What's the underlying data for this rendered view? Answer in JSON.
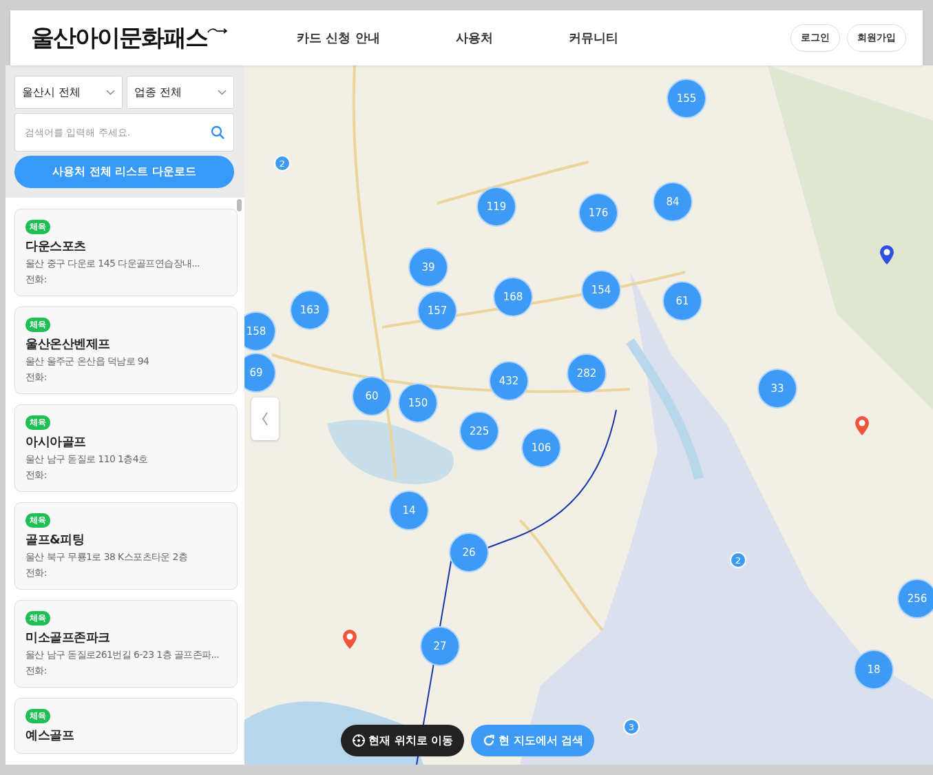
{
  "header": {
    "logo": "울산아이문화패스",
    "nav": [
      {
        "label": "카드 신청 안내"
      },
      {
        "label": "사용처"
      },
      {
        "label": "커뮤니티"
      }
    ],
    "auth_buttons": [
      "로그인",
      "회원가입"
    ]
  },
  "filters": {
    "region": "울산시 전체",
    "category": "업종 전체",
    "search": {
      "placeholder": "검색어를 입력해 주세요."
    },
    "download_button": "사용처 전체 리스트 다운로드"
  },
  "places": [
    {
      "tag": "체육",
      "name": "다운스포츠",
      "address": "울산 중구 다운로 145 다운골프연습장내...",
      "phone": "전화:"
    },
    {
      "tag": "체육",
      "name": "울산온산벤제프",
      "address": "울산 울주군 온산읍 덕남로 94",
      "phone": "전화:"
    },
    {
      "tag": "체육",
      "name": "아시아골프",
      "address": "울산 남구 돋질로 110 1층4호",
      "phone": "전화:"
    },
    {
      "tag": "체육",
      "name": "골프&피팅",
      "address": "울산 북구 무룡1로 38 K스포츠타운 2층",
      "phone": "전화:"
    },
    {
      "tag": "체육",
      "name": "미소골프존파크",
      "address": "울산 남구 돋질로261번길 6-23 1층 골프존파...",
      "phone": "전화:"
    },
    {
      "tag": "체육",
      "name": "예스골프"
    }
  ],
  "map": {
    "clusters": [
      {
        "count": "155",
        "kind": "large"
      },
      {
        "count": "2",
        "kind": "small"
      },
      {
        "count": "119",
        "kind": "large"
      },
      {
        "count": "176",
        "kind": "large"
      },
      {
        "count": "84",
        "kind": "large"
      },
      {
        "count": "39",
        "kind": "large"
      },
      {
        "count": "168",
        "kind": "large"
      },
      {
        "count": "154",
        "kind": "large"
      },
      {
        "count": "61",
        "kind": "large"
      },
      {
        "count": "163",
        "kind": "large"
      },
      {
        "count": "157",
        "kind": "large"
      },
      {
        "count": "158",
        "kind": "large"
      },
      {
        "count": "69",
        "kind": "large"
      },
      {
        "count": "282",
        "kind": "large"
      },
      {
        "count": "432",
        "kind": "large"
      },
      {
        "count": "60",
        "kind": "large"
      },
      {
        "count": "150",
        "kind": "large"
      },
      {
        "count": "33",
        "kind": "large"
      },
      {
        "count": "225",
        "kind": "large"
      },
      {
        "count": "106",
        "kind": "large"
      },
      {
        "count": "14",
        "kind": "large"
      },
      {
        "count": "26",
        "kind": "large"
      },
      {
        "count": "2",
        "kind": "small"
      },
      {
        "count": "256",
        "kind": "large"
      },
      {
        "count": "27",
        "kind": "large"
      },
      {
        "count": "18",
        "kind": "large"
      },
      {
        "count": "3",
        "kind": "small"
      }
    ],
    "pins": [
      {
        "color": "#2f4fe0"
      },
      {
        "color": "#f0553a"
      },
      {
        "color": "#f0553a"
      }
    ],
    "locate_button": "현재 위치로 이동",
    "research_button": "현 지도에서 검색"
  }
}
